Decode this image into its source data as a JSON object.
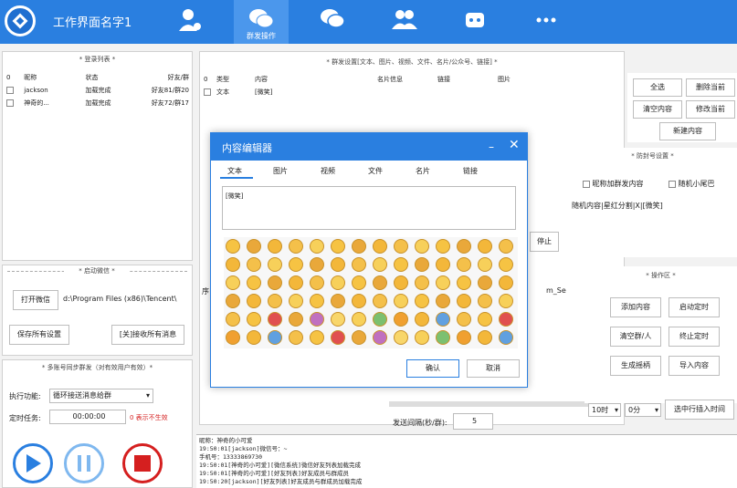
{
  "app": {
    "title": "工作界面名字1"
  },
  "nav": {
    "active_label": "群发操作"
  },
  "login_list": {
    "title": "* 登录列表 *",
    "headers": [
      "0",
      "昵称",
      "状态",
      "好友/群"
    ],
    "rows": [
      {
        "nick": "jackson",
        "status": "加载完成",
        "count": "好友81/群20"
      },
      {
        "nick": "神奇的...",
        "status": "加载完成",
        "count": "好友72/群17"
      }
    ]
  },
  "launch": {
    "title": "* 启动微信 *",
    "open_btn": "打开微信",
    "path": "d:\\Program Files (x86)\\Tencent\\",
    "save_btn": "保存所有设置",
    "recv_btn": "[关]接收所有消息"
  },
  "multi": {
    "title": "* 多账号同步群发（对有效用户有效）*",
    "exec_label": "执行功能:",
    "exec_value": "循环接送消息给群",
    "timer_label": "定时任务:",
    "timer_value": "00:00:00",
    "timer_note": "0 表示不生效"
  },
  "send_setting": {
    "title": "* 群发设置[文本、图片、视频、文件、名片/公众号、链接] *",
    "headers": [
      "0",
      "类型",
      "内容",
      "名片信息",
      "链接",
      "图片"
    ],
    "row": {
      "type": "文本",
      "content": "[微笑]"
    }
  },
  "right_btns": [
    "全选",
    "删除当前",
    "清空内容",
    "修改当前",
    "新建内容"
  ],
  "anti": {
    "title": "* 防封号设置 *",
    "opt1": "昵称加群发内容",
    "opt2": "随机小尾巴",
    "note": "随机内容|星红分割|X|[微笑]"
  },
  "stop_btn": "停止",
  "ops": {
    "title": "* 操作区 *",
    "buttons": [
      "添加内容",
      "启动定时",
      "清空群/人",
      "终止定时",
      "生成摇柄",
      "导入内容"
    ]
  },
  "col_label": "m_Se",
  "side_label": "序",
  "time_sel": {
    "hour": "10时",
    "minute": "0分",
    "btn": "选中行插入时间"
  },
  "interval": {
    "label": "发送间隔(秒/群):",
    "value": "5"
  },
  "log": {
    "lines": [
      "昵称：神奇的小可爱",
      "19:50:01[jackson]微信号：~",
      "手机号：13333869730",
      "19:50:01[神奇的小可爱][微信系统]微信好友列表加载完成",
      "19:50:01[神奇的小可爱][好友列表]好友成员与群成员",
      "19:50:20[jackson][好友列表]好友成员与群成员加载完成"
    ]
  },
  "dialog": {
    "title": "内容编辑器",
    "tabs": [
      "文本",
      "图片",
      "视频",
      "文件",
      "名片",
      "链接"
    ],
    "text": "[微笑]",
    "confirm": "确认",
    "cancel": "取消"
  },
  "colors": {
    "primary": "#2a7fe0",
    "danger": "#d51f1f",
    "play": "#2a7fe0"
  }
}
